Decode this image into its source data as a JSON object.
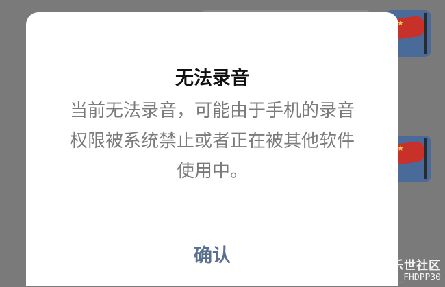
{
  "dialog": {
    "title": "无法录音",
    "message_line1": "当前无法录音，可能由于手机的录音",
    "message_line2": "权限被系统禁止或者正在被其他软件",
    "message_line3": "使用中。",
    "confirm_label": "确认"
  },
  "watermark": {
    "brand": "盖乐世社区",
    "handle": "@GC_FHDPP30"
  },
  "colors": {
    "overlay": "#7a7a7a",
    "dialog_bg": "#ffffff",
    "title": "#111111",
    "message": "#7b7b7b",
    "confirm": "#5a6f8f"
  }
}
